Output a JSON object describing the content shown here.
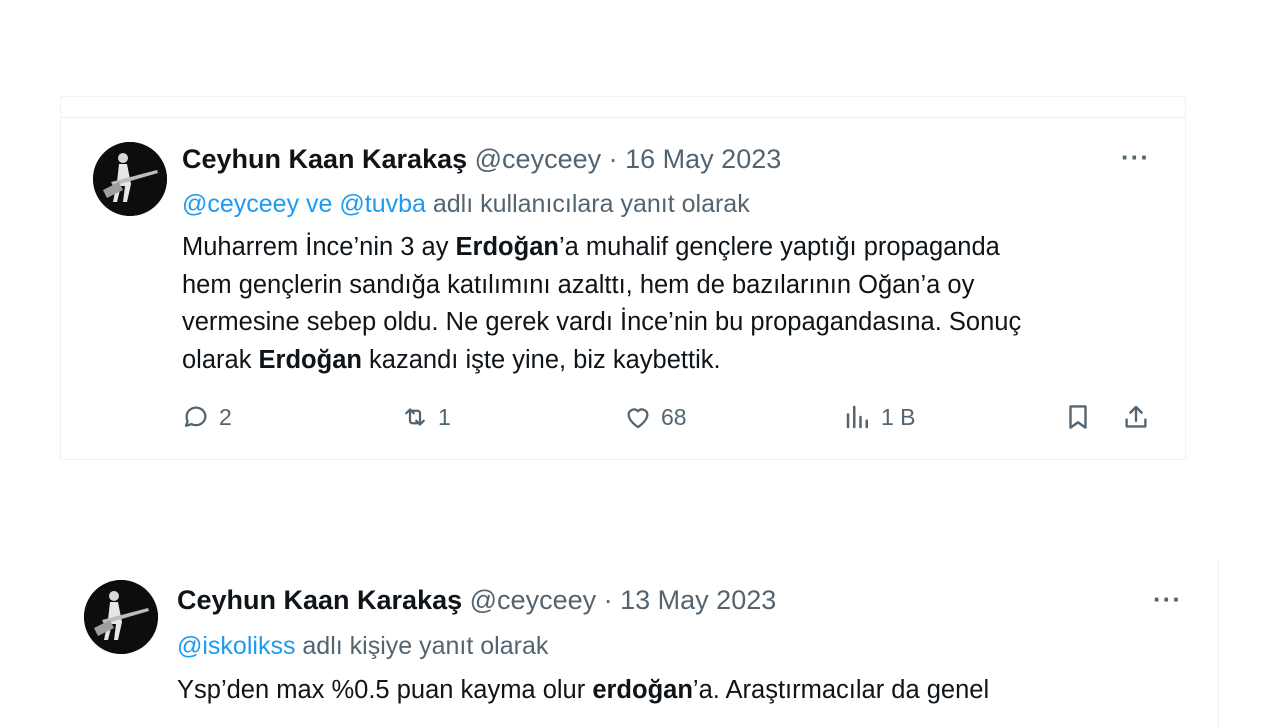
{
  "tweets": [
    {
      "author": {
        "name": "Ceyhun Kaan Karakaş",
        "handle": "@ceyceey"
      },
      "separator": "·",
      "date": "16 May 2023",
      "reply_to": {
        "mentions": "@ceyceey ve @tuvba",
        "suffix": "adlı kullanıcılara yanıt olarak"
      },
      "text_lines": [
        [
          "Muharrem İnce’nin 3 ay ",
          "Erdoğan",
          "’a muhalif gençlere yaptığı propaganda"
        ],
        [
          "hem gençlerin sandığa katılımını azalttı, hem de bazılarının Oğan’a oy"
        ],
        [
          "vermesine sebep oldu. Ne gerek vardı İnce’nin bu propagandasına. Sonuç"
        ],
        [
          "olarak ",
          "Erdoğan",
          " kazandı işte yine, biz kaybettik."
        ]
      ],
      "stats": {
        "replies": "2",
        "retweets": "1",
        "likes": "68",
        "views": "1 B"
      },
      "icons": [
        "reply-icon",
        "retweet-icon",
        "like-icon",
        "views-icon",
        "bookmark-icon",
        "share-icon"
      ]
    },
    {
      "author": {
        "name": "Ceyhun Kaan Karakaş",
        "handle": "@ceyceey"
      },
      "separator": "·",
      "date": "13 May 2023",
      "reply_to": {
        "mentions": "@iskolikss",
        "suffix": "adlı kişiye yanıt olarak"
      },
      "text_lines": [
        [
          "Ysp’den max %0.5 puan kayma olur ",
          "erdoğan",
          "’a. Araştırmacılar da genel"
        ]
      ]
    }
  ],
  "more_label": "···",
  "colors": {
    "text": "#0f1419",
    "muted": "#536471",
    "link": "#1d9bf0"
  }
}
